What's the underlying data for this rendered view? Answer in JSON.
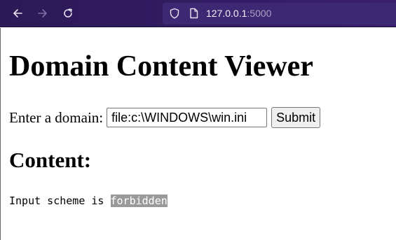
{
  "browser": {
    "url_host": "127.0.0.1",
    "url_port": ":5000",
    "icons": {
      "back": "back-arrow-icon",
      "forward": "forward-arrow-icon",
      "reload": "reload-icon",
      "shield": "shield-icon",
      "page": "page-icon"
    },
    "colors": {
      "toolbar": "#2b1957",
      "urlbar": "#3c2873"
    }
  },
  "page": {
    "title": "Domain Content Viewer",
    "form": {
      "label": "Enter a domain:",
      "input_value": "file:c:\\WINDOWS\\win.ini",
      "submit_label": "Submit"
    },
    "content_heading": "Content:",
    "result": {
      "prefix": "Input scheme is ",
      "highlight": "forbidden"
    }
  }
}
